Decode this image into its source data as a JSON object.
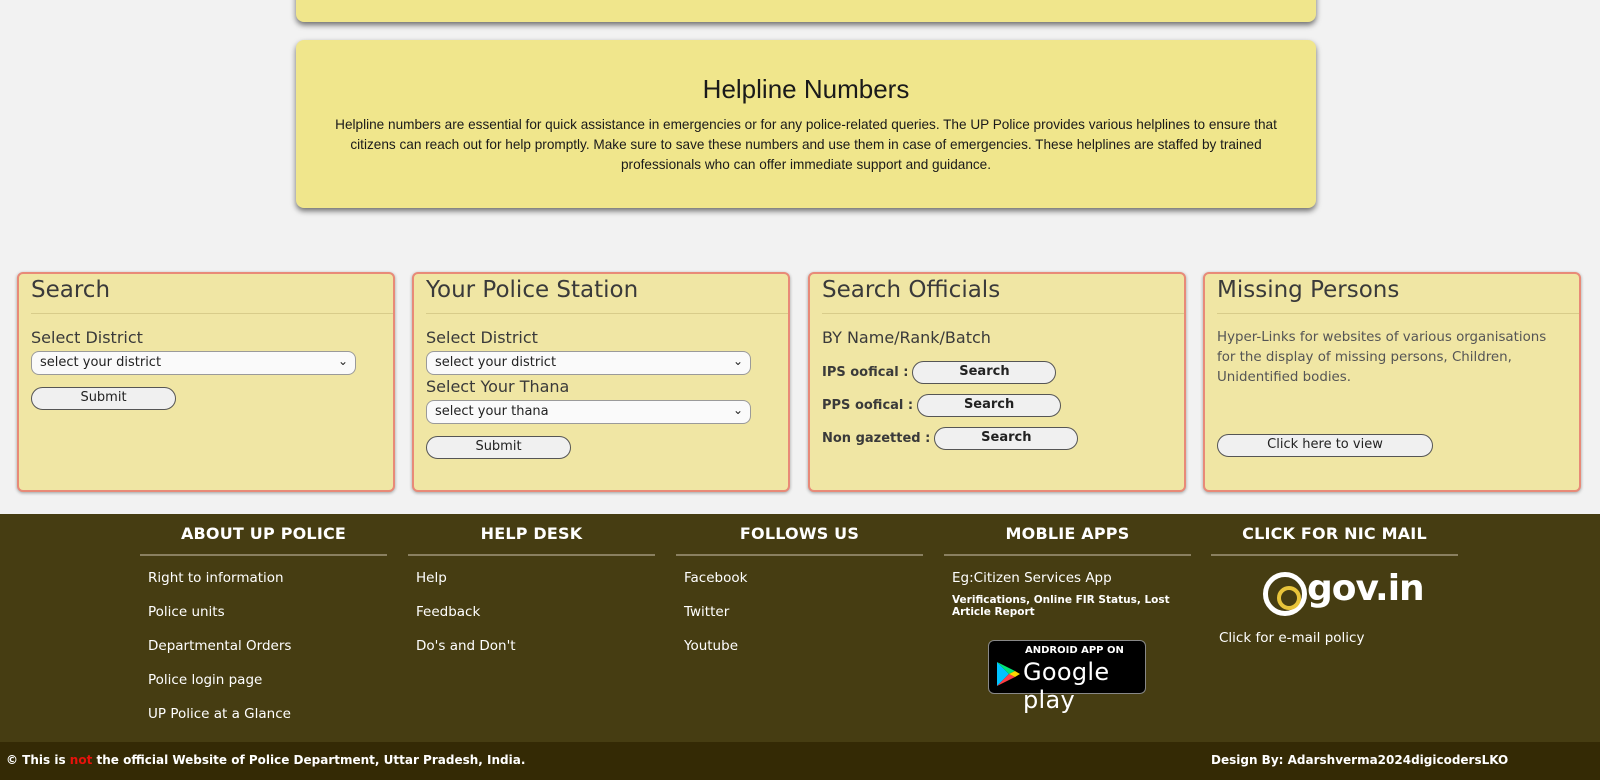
{
  "helpline": {
    "title": "Helpline Numbers",
    "text": "Helpline numbers are essential for quick assistance in emergencies or for any police-related queries. The UP Police provides various helplines to ensure that citizens can reach out for help promptly. Make sure to save these numbers and use them in case of emergencies. These helplines are staffed by trained professionals who can offer immediate support and guidance."
  },
  "search": {
    "title": "Search",
    "district_label": "Select District",
    "district_value": "select your district",
    "submit": "Submit"
  },
  "police_station": {
    "title": "Your Police Station",
    "district_label": "Select District",
    "district_value": "select your district",
    "thana_label": "Select Your Thana",
    "thana_value": "select your thana",
    "submit": "Submit"
  },
  "officials": {
    "title": "Search Officials",
    "subtitle": "BY Name/Rank/Batch",
    "rows": [
      {
        "label": "IPS oofical :",
        "button": "Search"
      },
      {
        "label": "PPS oofical :",
        "button": "Search"
      },
      {
        "label": "Non gazetted :",
        "button": "Search"
      }
    ]
  },
  "missing": {
    "title": "Missing Persons",
    "text": "Hyper-Links for websites of various organisations for the display of missing persons, Children, Unidentified bodies.",
    "button": "Click here to view"
  },
  "footer": {
    "about": {
      "heading": "ABOUT UP POLICE",
      "links": [
        "Right to information",
        "Police units",
        "Departmental Orders",
        "Police login page",
        "UP Police at a Glance"
      ]
    },
    "helpdesk": {
      "heading": "HELP DESK",
      "links": [
        "Help",
        "Feedback",
        "Do's and Don't"
      ]
    },
    "follow": {
      "heading": "FOLLOWS US",
      "links": [
        "Facebook",
        "Twitter",
        "Youtube"
      ]
    },
    "apps": {
      "heading": "MOBLIE APPS",
      "app_name": "Eg:Citizen Services App",
      "app_desc": "Verifications, Online FIR Status, Lost Article Report",
      "badge_small": "ANDROID APP ON",
      "badge_big": "Google play"
    },
    "nic": {
      "heading": "CLICK FOR NIC MAIL",
      "logo_text": "gov.in",
      "policy": "Click for e-mail policy"
    }
  },
  "bottom": {
    "left_pre": "© This is",
    "left_red": "not",
    "left_post": "the official Website of Police Department, Uttar Pradesh, India.",
    "right": "Design By: Adarshverma2024digicodersLKO"
  },
  "colors": {
    "card_bg": "#f0e68c",
    "widget_border": "#e88a78",
    "footer_bg": "#463d12",
    "bottom_bg": "#342a05",
    "accent_red": "#e8120c"
  }
}
